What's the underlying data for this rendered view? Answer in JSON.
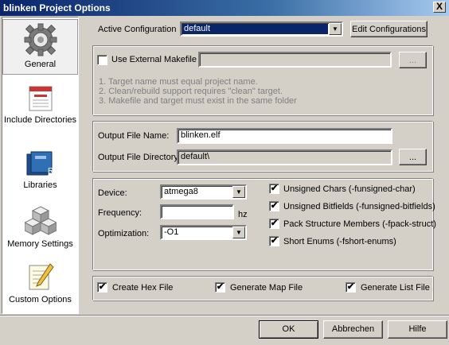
{
  "window": {
    "title": "blinken Project Options",
    "close_glyph": "X"
  },
  "sidebar": {
    "items": [
      {
        "label": "General",
        "icon": "gear-icon"
      },
      {
        "label": "Include Directories",
        "icon": "include-directories-icon"
      },
      {
        "label": "Libraries",
        "icon": "libraries-icon"
      },
      {
        "label": "Memory Settings",
        "icon": "memory-settings-icon"
      },
      {
        "label": "Custom Options",
        "icon": "custom-options-icon"
      }
    ]
  },
  "config": {
    "active_label": "Active Configuration",
    "active_value": "default",
    "edit_button": "Edit Configurations"
  },
  "makefile": {
    "checkbox_label": "Use External Makefile",
    "checked": false,
    "path_value": "",
    "browse_button": "...",
    "notes": [
      "1. Target name must equal project name.",
      "2. Clean/rebuild support requires \"clean\" target.",
      "3. Makefile and target must exist in the same folder"
    ]
  },
  "output": {
    "file_name_label": "Output File Name:",
    "file_name_value": "blinken.elf",
    "directory_label": "Output File Directory:",
    "directory_value": "default\\",
    "browse_button": "..."
  },
  "device": {
    "device_label": "Device:",
    "device_value": "atmega8",
    "frequency_label": "Frequency:",
    "frequency_value": "",
    "frequency_unit": "hz",
    "optimization_label": "Optimization:",
    "optimization_value": "-O1"
  },
  "compiler_flags": [
    {
      "label": "Unsigned Chars (-funsigned-char)",
      "checked": true
    },
    {
      "label": "Unsigned Bitfields (-funsigned-bitfields)",
      "checked": true
    },
    {
      "label": "Pack Structure Members (-fpack-struct)",
      "checked": true
    },
    {
      "label": "Short Enums (-fshort-enums)",
      "checked": true
    }
  ],
  "outputs": {
    "hex_label": "Create Hex File",
    "map_label": "Generate Map File",
    "list_label": "Generate List File"
  },
  "check_glyph": "✔",
  "dropdown_glyph": "▼",
  "buttons": {
    "ok": "OK",
    "cancel": "Abbrechen",
    "help": "Hilfe"
  }
}
